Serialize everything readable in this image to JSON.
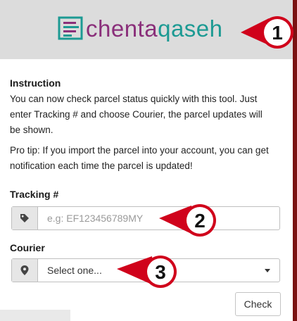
{
  "brand": {
    "name_part1": "chenta",
    "name_part2": "qaseh",
    "color_primary": "#8a2f7a",
    "color_secondary": "#1c9a93"
  },
  "callouts": [
    {
      "number": "1",
      "target": "logo"
    },
    {
      "number": "2",
      "target": "tracking-input"
    },
    {
      "number": "3",
      "target": "courier-select"
    }
  ],
  "instruction": {
    "heading": "Instruction",
    "line1": "You can now check parcel status quickly with this tool. Just",
    "line2": "enter Tracking # and choose Courier, the parcel updates will",
    "line3": "be shown.",
    "tip1": "Pro tip: If you import the parcel into your account, you can get",
    "tip2": "notification each time the parcel is updated!"
  },
  "form": {
    "tracking_label": "Tracking #",
    "tracking_placeholder": "e.g: EF123456789MY",
    "tracking_value": "",
    "tracking_icon": "tag-icon",
    "courier_label": "Courier",
    "courier_selected": "Select one...",
    "courier_icon": "map-marker-icon",
    "check_label": "Check"
  },
  "colors": {
    "header_bg": "#dcdcdc",
    "callout_red": "#d0021b",
    "accent_bar": "#7a1212"
  }
}
